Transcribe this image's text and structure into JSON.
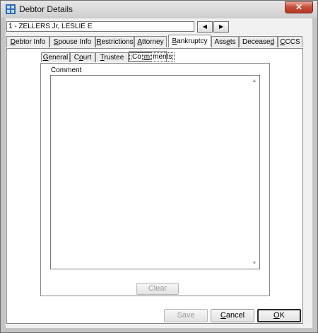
{
  "window": {
    "title": "Debtor Details",
    "close_label": "✕"
  },
  "debtor_select": {
    "value": "1 - ZELLERS Jr, LESLIE E"
  },
  "nav": {
    "prev": "◀",
    "next": "▶"
  },
  "tabs": [
    {
      "pre": "",
      "ul": "D",
      "post": "ebtor Info"
    },
    {
      "pre": "",
      "ul": "S",
      "post": "pouse Info"
    },
    {
      "pre": "",
      "ul": "R",
      "post": "estrictions"
    },
    {
      "pre": "",
      "ul": "A",
      "post": "ttorney"
    },
    {
      "pre": "",
      "ul": "B",
      "post": "ankruptcy"
    },
    {
      "pre": "Ass",
      "ul": "e",
      "post": "ts"
    },
    {
      "pre": "Decease",
      "ul": "d",
      "post": ""
    },
    {
      "pre": "",
      "ul": "C",
      "post": "CCS"
    }
  ],
  "subtabs": [
    {
      "pre": "",
      "ul": "G",
      "post": "eneral"
    },
    {
      "pre": "C",
      "ul": "o",
      "post": "urt"
    },
    {
      "pre": "",
      "ul": "T",
      "post": "rustee"
    },
    {
      "pre": "Co",
      "ul": "m",
      "post": "ments"
    }
  ],
  "comment": {
    "label": "Comment",
    "text": ""
  },
  "buttons": {
    "clear": "Clear",
    "save": "Save",
    "cancel": {
      "pre": "",
      "ul": "C",
      "post": "ancel"
    },
    "ok": {
      "pre": "",
      "ul": "O",
      "post": "K"
    }
  }
}
